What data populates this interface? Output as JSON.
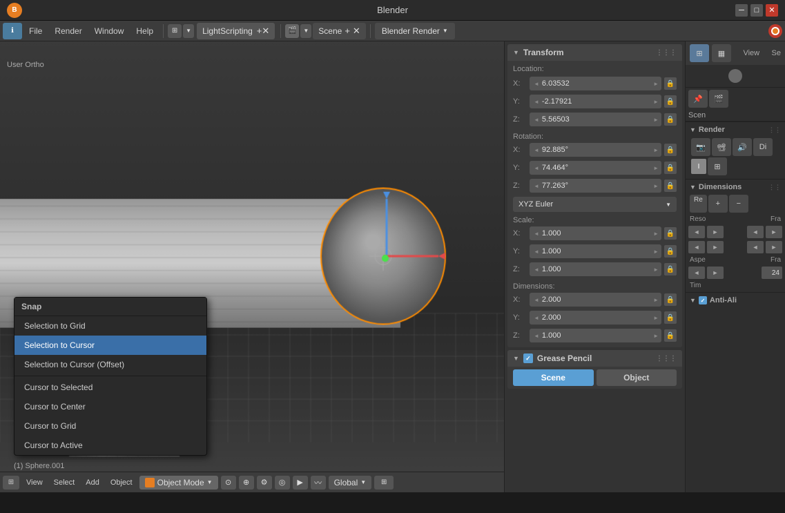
{
  "titlebar": {
    "title": "Blender",
    "min_label": "─",
    "max_label": "□",
    "close_label": "✕"
  },
  "menubar": {
    "file_label": "File",
    "render_label": "Render",
    "window_label": "Window",
    "help_label": "Help",
    "workspace_label": "LightScripting",
    "scene_label": "Scene",
    "render_engine_label": "Blender Render"
  },
  "viewport": {
    "view_label": "User Ortho",
    "corner_label": "User Ortho",
    "object_info": "(1) Sphere.001"
  },
  "snap_menu": {
    "header": "Snap",
    "items": [
      {
        "id": "selection-to-grid",
        "label": "Selection to Grid",
        "active": false
      },
      {
        "id": "selection-to-cursor",
        "label": "Selection to Cursor",
        "active": true
      },
      {
        "id": "selection-to-cursor-offset",
        "label": "Selection to Cursor (Offset)",
        "active": false
      },
      {
        "id": "cursor-to-selected",
        "label": "Cursor to Selected",
        "active": false
      },
      {
        "id": "cursor-to-center",
        "label": "Cursor to Center",
        "active": false
      },
      {
        "id": "cursor-to-grid",
        "label": "Cursor to Grid",
        "active": false
      },
      {
        "id": "cursor-to-active",
        "label": "Cursor to Active",
        "active": false
      }
    ]
  },
  "transform_panel": {
    "header": "Transform",
    "location_label": "Location:",
    "location_x_label": "X:",
    "location_x_value": "6.03532",
    "location_y_label": "Y:",
    "location_y_value": "-2.17921",
    "location_z_label": "Z:",
    "location_z_value": "5.56503",
    "rotation_label": "Rotation:",
    "rotation_x_label": "X:",
    "rotation_x_value": "92.885°",
    "rotation_y_label": "Y:",
    "rotation_y_value": "74.464°",
    "rotation_z_label": "Z:",
    "rotation_z_value": "77.263°",
    "euler_label": "XYZ Euler",
    "scale_label": "Scale:",
    "scale_x_label": "X:",
    "scale_x_value": "1.000",
    "scale_y_label": "Y:",
    "scale_y_value": "1.000",
    "scale_z_label": "Z:",
    "scale_z_value": "1.000",
    "dimensions_label": "Dimensions:",
    "dim_x_label": "X:",
    "dim_x_value": "2.000",
    "dim_y_label": "Y:",
    "dim_y_value": "2.000",
    "dim_z_label": "Z:",
    "dim_z_value": "1.000"
  },
  "grease_pencil": {
    "header": "Grease Pencil",
    "scene_btn": "Scene",
    "object_btn": "Object"
  },
  "right_panel": {
    "view_label": "View",
    "se_label": "Se",
    "scene_label": "Scen",
    "render_label": "Render",
    "dimensions_label": "Dimensions",
    "reso_label": "Reso",
    "fra_label": "Fra",
    "aspe_label": "Aspe",
    "fra2_label": "Fra",
    "fra2_value": "24",
    "tim_label": "Tim",
    "anti_label": "Anti-Ali"
  },
  "bottom_bar": {
    "view_label": "View",
    "select_label": "Select",
    "add_label": "Add",
    "object_label": "Object",
    "mode_label": "Object Mode",
    "global_label": "Global"
  }
}
